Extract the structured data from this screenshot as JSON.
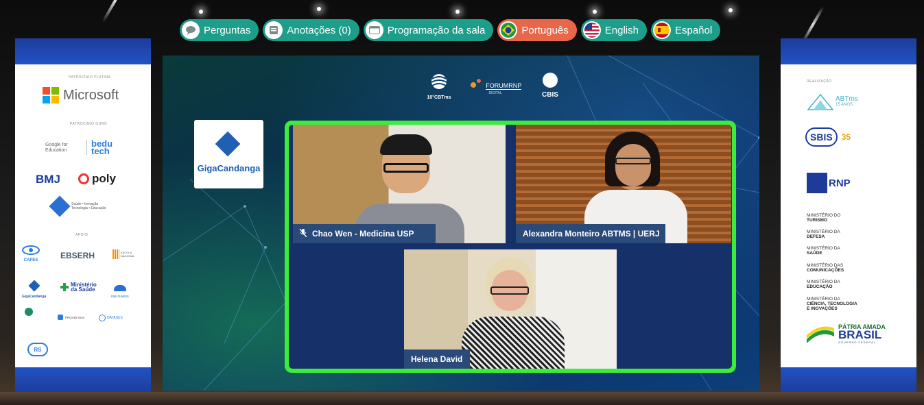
{
  "toolbar": {
    "questions": "Perguntas",
    "notes": "Anotações (0)",
    "schedule": "Programação da sala",
    "lang_pt": "Português",
    "lang_en": "English",
    "lang_es": "Español"
  },
  "icons": {
    "questions": "speech-bubble-icon",
    "notes": "note-icon",
    "schedule": "calendar-icon",
    "pt": "brazil-flag-icon",
    "en": "usa-flag-icon",
    "es": "spain-flag-icon",
    "mic_off": "microphone-muted-icon"
  },
  "colors": {
    "toolbar_button": "#1d9e8a",
    "toolbar_active": "#e8664a",
    "video_border": "#3cec3a",
    "name_tag": "#2a4a7a"
  },
  "left_banner": {
    "label_platinum": "PATROCÍNIO PLATINA",
    "sponsor_microsoft": "Microsoft",
    "label_gold": "PATROCÍNIO OURO",
    "sponsor_google": "Google for Education",
    "sponsor_bedu": "bedu tech",
    "sponsor_bmj": "BMJ",
    "sponsor_poly": "poly",
    "sponsor_cafe": "Saúde • Inovação Tecnologia • Educação",
    "label_support": "APOIO",
    "sponsor_capes": "CAPES",
    "sponsor_ebserh": "EBSERH",
    "sponsor_escola": "ESCOLA NACIONAL",
    "sponsor_giga": "GigaCandanga",
    "sponsor_saude": "Ministério da Saúde",
    "sponsor_nuvem": "nas nuvens",
    "sponsor_proadi": "PROADI-SUS",
    "sponsor_datasus": "DATASUS",
    "sponsor_rs": "RS"
  },
  "right_banner": {
    "label_realization": "REALIZAÇÃO",
    "abtms": "ABTms",
    "abtms_sub": "15 ANOS",
    "sbis": "SBIS",
    "sbis_years": "35",
    "rnp": "RNP",
    "min_turismo_1": "MINISTÉRIO DO",
    "min_turismo_2": "TURISMO",
    "min_defesa_1": "MINISTÉRIO DA",
    "min_defesa_2": "DEFESA",
    "min_saude_1": "MINISTÉRIO DA",
    "min_saude_2": "SAÚDE",
    "min_com_1": "MINISTÉRIO DAS",
    "min_com_2": "COMUNICAÇÕES",
    "min_edu_1": "MINISTÉRIO DA",
    "min_edu_2": "EDUCAÇÃO",
    "min_cti_1": "MINISTÉRIO DA",
    "min_cti_2": "CIÊNCIA, TECNOLOGIA",
    "min_cti_3": "E INOVAÇÕES",
    "brasil_1": "PÁTRIA AMADA",
    "brasil_2": "BRASIL",
    "brasil_3": "GOVERNO FEDERAL"
  },
  "stage": {
    "logo_gc": "GigaCandanga",
    "logo_cbtms": "10°CBTms",
    "logo_forum": "FORUMRNP",
    "logo_forum_sub": "DIGITAL",
    "logo_cbis": "CBIS"
  },
  "participants": [
    {
      "name": "Chao Wen - Medicina USP",
      "muted": true
    },
    {
      "name": "Alexandra Monteiro ABTMS | UERJ",
      "muted": false
    },
    {
      "name": "Helena David",
      "muted": false
    }
  ]
}
